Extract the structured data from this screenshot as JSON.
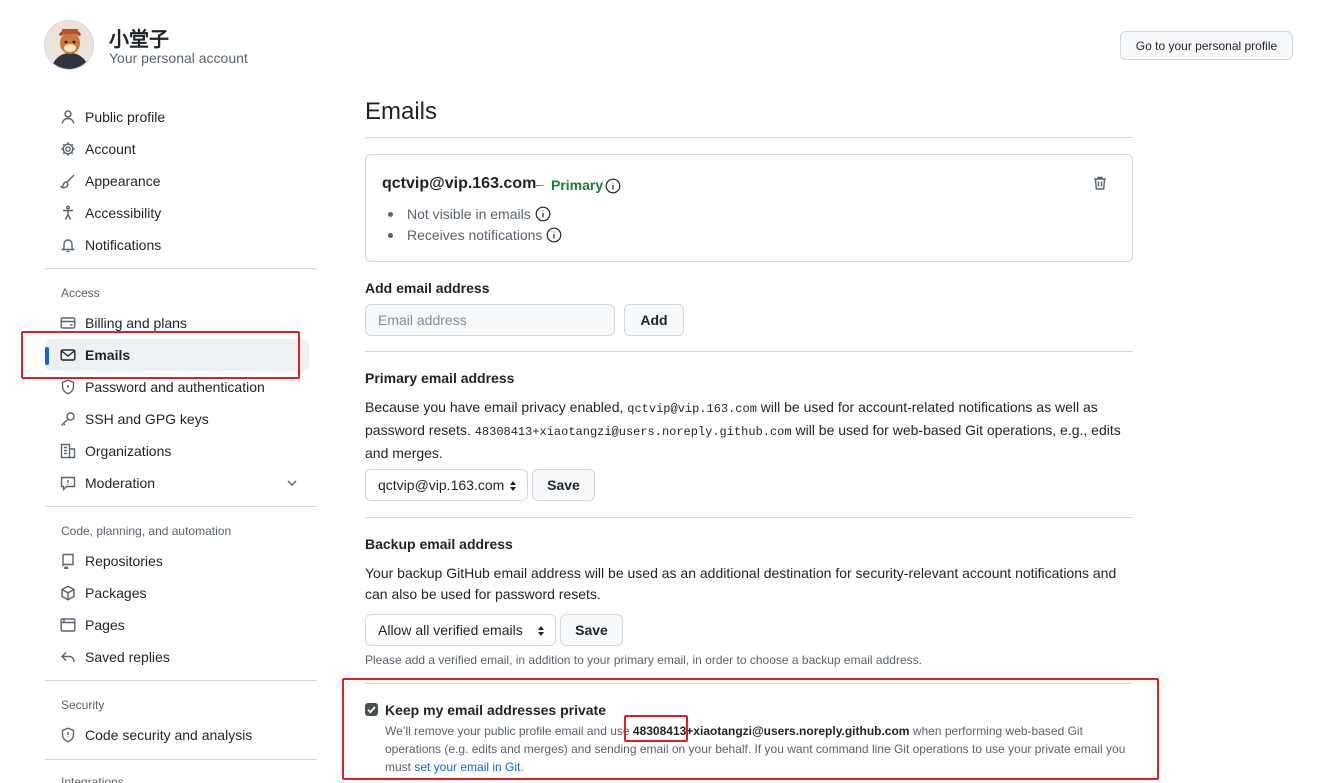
{
  "user": {
    "name": "小堂子",
    "subtitle": "Your personal account",
    "profile_button": "Go to your personal profile"
  },
  "sidebar": {
    "items_top": [
      {
        "label": "Public profile",
        "icon": "person-icon"
      },
      {
        "label": "Account",
        "icon": "gear-icon"
      },
      {
        "label": "Appearance",
        "icon": "paintbrush-icon"
      },
      {
        "label": "Accessibility",
        "icon": "accessibility-icon"
      },
      {
        "label": "Notifications",
        "icon": "bell-icon"
      }
    ],
    "access_heading": "Access",
    "items_access": [
      {
        "label": "Billing and plans",
        "icon": "credit-card-icon"
      },
      {
        "label": "Emails",
        "icon": "mail-icon",
        "active": true
      },
      {
        "label": "Password and authentication",
        "icon": "shield-lock-icon"
      },
      {
        "label": "SSH and GPG keys",
        "icon": "key-icon"
      },
      {
        "label": "Organizations",
        "icon": "organization-icon"
      },
      {
        "label": "Moderation",
        "icon": "report-icon"
      }
    ],
    "code_heading": "Code, planning, and automation",
    "items_code": [
      {
        "label": "Repositories",
        "icon": "repo-icon"
      },
      {
        "label": "Packages",
        "icon": "package-icon"
      },
      {
        "label": "Pages",
        "icon": "browser-icon"
      },
      {
        "label": "Saved replies",
        "icon": "reply-icon"
      }
    ],
    "security_heading": "Security",
    "items_security": [
      {
        "label": "Code security and analysis",
        "icon": "shield-icon"
      }
    ],
    "integrations_heading": "Integrations"
  },
  "main": {
    "title": "Emails",
    "email_card": {
      "address": "qctvip@vip.163.com",
      "dash": "–",
      "badge": "Primary",
      "bullets": [
        "Not visible in emails",
        "Receives notifications"
      ]
    },
    "add_email": {
      "title": "Add email address",
      "placeholder": "Email address",
      "button": "Add"
    },
    "primary": {
      "title": "Primary email address",
      "text_1": "Because you have email privacy enabled, ",
      "code_1": "qctvip@vip.163.com",
      "text_2": " will be used for account-related notifications as well as password resets. ",
      "code_2": "48308413+xiaotangzi@users.noreply.github.com",
      "text_3": " will be used for web-based Git operations, e.g., edits and merges.",
      "select_value": "qctvip@vip.163.com",
      "button": "Save"
    },
    "backup": {
      "title": "Backup email address",
      "text": "Your backup GitHub email address will be used as an additional destination for security-relevant account notifications and can also be used for password resets.",
      "select_value": "Allow all verified emails",
      "button": "Save",
      "note": "Please add a verified email, in addition to your primary email, in order to choose a backup email address."
    },
    "keep_private": {
      "checked": true,
      "title": "Keep my email addresses private",
      "desc_1": "We’ll remove your public profile email and use ",
      "noreply_id": "48308413",
      "noreply_rest": "+xiaotangzi@users.noreply.github.com",
      "desc_2": " when performing web-based Git operations (e.g. edits and merges) and sending email on your behalf. If you want command line Git operations to use your private email you must ",
      "link": "set your email in Git",
      "desc_3": "."
    }
  },
  "colors": {
    "accent": "#0969da",
    "primary_badge": "#1a7f37",
    "annotation": "#e02020"
  }
}
